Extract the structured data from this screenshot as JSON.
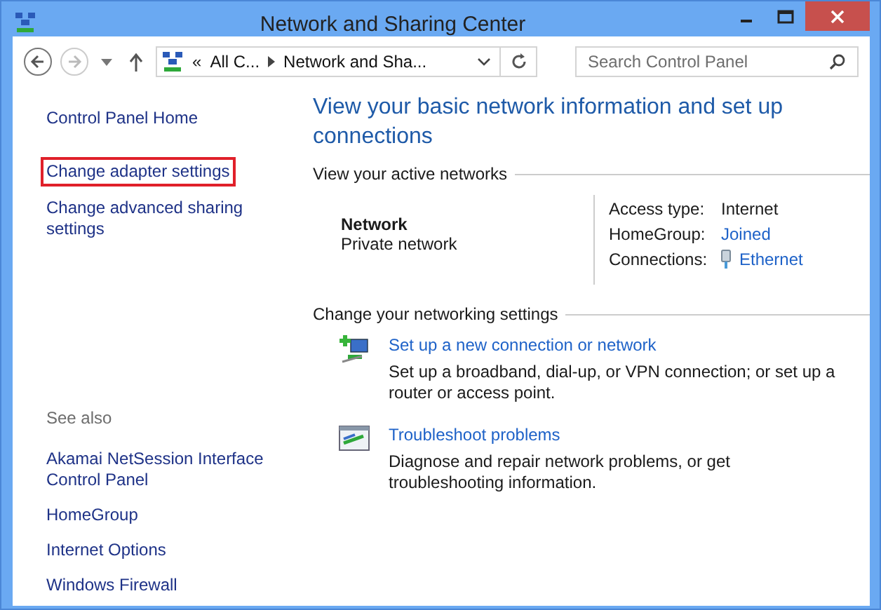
{
  "window": {
    "title": "Network and Sharing Center"
  },
  "address_bar": {
    "overflow": "«",
    "crumbs": [
      "All C...",
      "Network and Sha..."
    ]
  },
  "search": {
    "placeholder": "Search Control Panel"
  },
  "sidebar": {
    "items": [
      {
        "label": "Control Panel Home",
        "highlighted": false
      },
      {
        "label": "Change adapter settings",
        "highlighted": true
      },
      {
        "label": "Change advanced sharing settings",
        "highlighted": false
      }
    ],
    "see_also_heading": "See also",
    "see_also": [
      "Akamai NetSession Interface Control Panel",
      "HomeGroup",
      "Internet Options",
      "Windows Firewall"
    ]
  },
  "main": {
    "heading": "View your basic network information and set up connections",
    "active_networks": {
      "title": "View your active networks",
      "name": "Network",
      "type": "Private network",
      "properties": [
        {
          "label": "Access type:",
          "value": "Internet",
          "kind": "text"
        },
        {
          "label": "HomeGroup:",
          "value": "Joined",
          "kind": "link"
        },
        {
          "label": "Connections:",
          "value": "Ethernet",
          "kind": "connection"
        }
      ]
    },
    "settings": {
      "title": "Change your networking settings",
      "tasks": [
        {
          "kind": "new-connection",
          "link": "Set up a new connection or network",
          "description": "Set up a broadband, dial-up, or VPN connection; or set up a router or access point."
        },
        {
          "kind": "troubleshoot",
          "link": "Troubleshoot problems",
          "description": "Diagnose and repair network problems, or get troubleshooting information."
        }
      ]
    }
  }
}
